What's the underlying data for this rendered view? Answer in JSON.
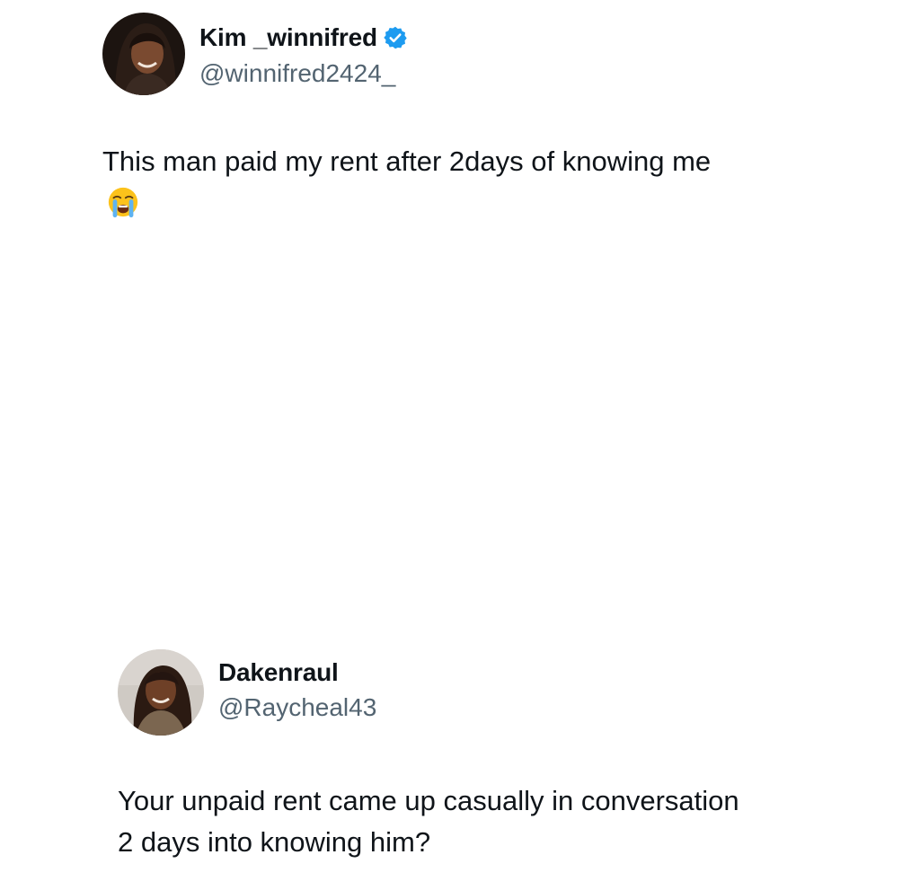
{
  "original_tweet": {
    "display_name": "Kim _winnifred",
    "verified": true,
    "handle": "@winnifred2424_",
    "text": "This man paid my rent after 2days of knowing me",
    "emoji": "loudly-crying-face",
    "badge_color": "#1d9bf0"
  },
  "reply_tweet": {
    "display_name": "Dakenraul",
    "verified": false,
    "handle": "@Raycheal43",
    "text_line_1": "Your unpaid rent came up casually in conversation",
    "text_line_2": "2 days into knowing him?"
  },
  "colors": {
    "text_primary": "#0f1419",
    "text_secondary": "#536471",
    "background": "#ffffff"
  }
}
